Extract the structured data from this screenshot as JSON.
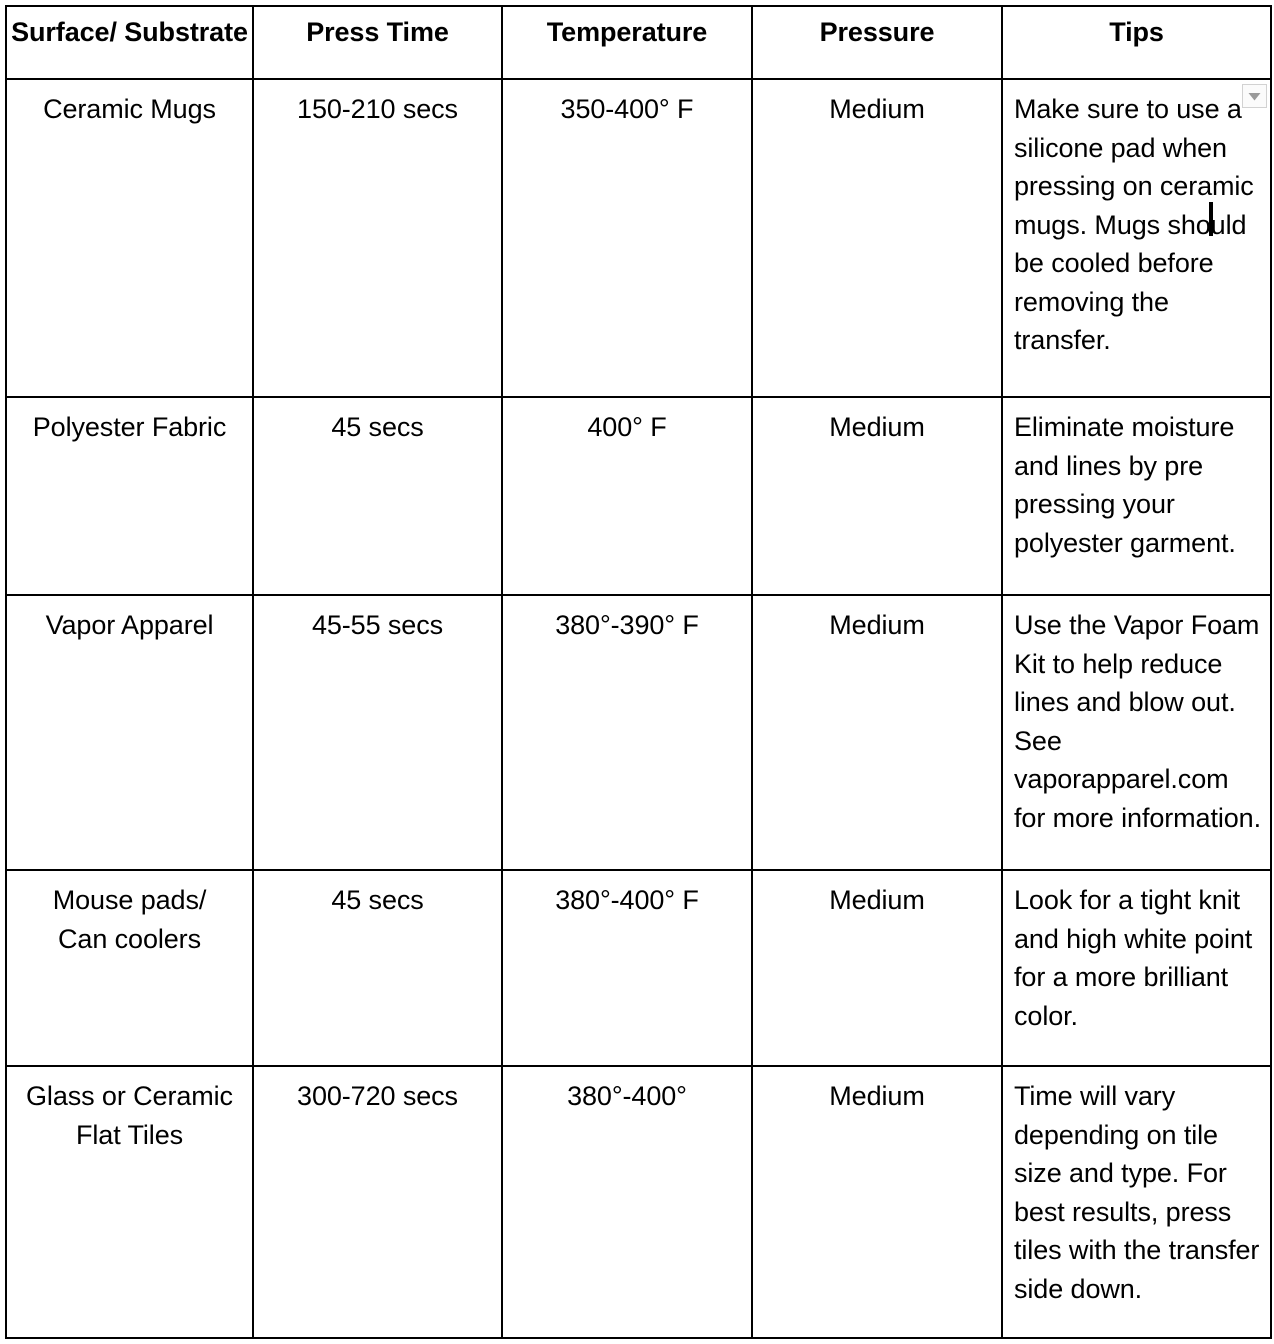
{
  "table": {
    "columns": [
      {
        "key": "surface",
        "label": "Surface/\nSubstrate",
        "align": "center"
      },
      {
        "key": "time",
        "label": "Press Time",
        "align": "center"
      },
      {
        "key": "temp",
        "label": "Temperature",
        "align": "center"
      },
      {
        "key": "pressure",
        "label": "Pressure",
        "align": "center"
      },
      {
        "key": "tips",
        "label": "Tips",
        "align": "center"
      }
    ],
    "rows": [
      {
        "surface": "Ceramic Mugs",
        "time": "150-210 secs",
        "temp": "350-400° F",
        "pressure": "Medium",
        "tips": "Make sure to use a silicone pad when pressing on ceramic mugs.  Mugs should be cooled before removing the transfer."
      },
      {
        "surface": "Polyester Fabric",
        "time": "45 secs",
        "temp": "400° F",
        "pressure": "Medium",
        "tips": "Eliminate moisture and lines by pre pressing your polyester garment."
      },
      {
        "surface": "Vapor Apparel",
        "time": "45-55 secs",
        "temp": "380°-390° F",
        "pressure": "Medium",
        "tips": "Use the Vapor Foam Kit to help reduce lines and blow out. See vaporapparel.com for more information."
      },
      {
        "surface": "Mouse pads/\nCan coolers",
        "time": "45 secs",
        "temp": "380°-400° F",
        "pressure": "Medium",
        "tips": "Look for a tight knit and high white point for a more brilliant color."
      },
      {
        "surface": "Glass or Ceramic\nFlat Tiles",
        "time": "300-720 secs",
        "temp": "380°-400°",
        "pressure": "Medium",
        "tips": "Time will vary depending on tile size and type. For best results, press tiles with the transfer side down."
      }
    ]
  },
  "overlays": {
    "dropdown_icon": "chevron-down-icon",
    "caret_present": true
  },
  "colors": {
    "border": "#000000",
    "text": "#000000",
    "background": "#ffffff",
    "dropdown_border": "#d2d2d2",
    "dropdown_fill": "#fbfbfb",
    "dropdown_glyph": "#9a9a9a"
  }
}
